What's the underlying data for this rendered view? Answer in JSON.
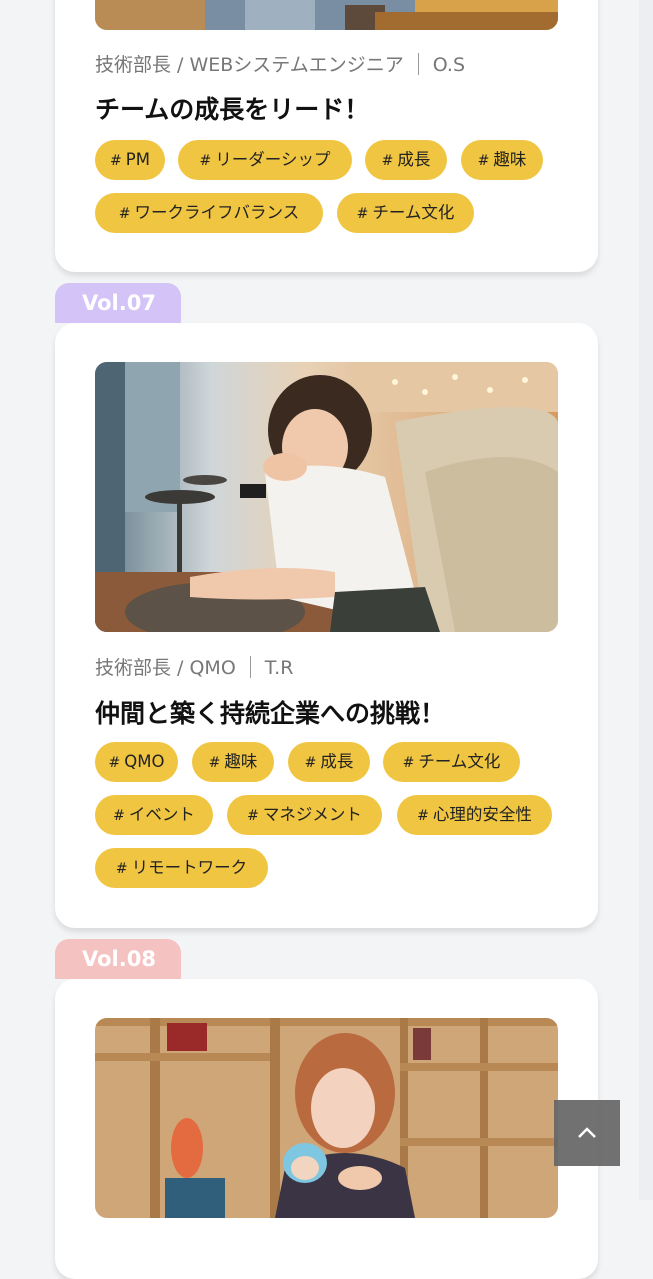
{
  "colors": {
    "tag_bg": "#f0c541",
    "vol07_tab": "#d3c3f7",
    "vol08_tab": "#f5c2c2"
  },
  "articles": [
    {
      "dept": "技術部長 / WEBシステムエンジニア",
      "initials": "O.S",
      "title": "チームの成長をリード！",
      "tags": [
        "PM",
        "リーダーシップ",
        "成長",
        "趣味",
        "ワークライフバランス",
        "チーム文化"
      ]
    },
    {
      "vol": "Vol.07",
      "dept": "技術部長 / QMO",
      "initials": "T.R",
      "title": "仲間と築く持続企業への挑戦！",
      "tags": [
        "QMO",
        "趣味",
        "成長",
        "チーム文化",
        "イベント",
        "マネジメント",
        "心理的安全性",
        "リモートワーク"
      ]
    },
    {
      "vol": "Vol.08"
    }
  ],
  "tag_prefix": "#",
  "scroll_top": {
    "icon": "chevron-up-icon"
  }
}
